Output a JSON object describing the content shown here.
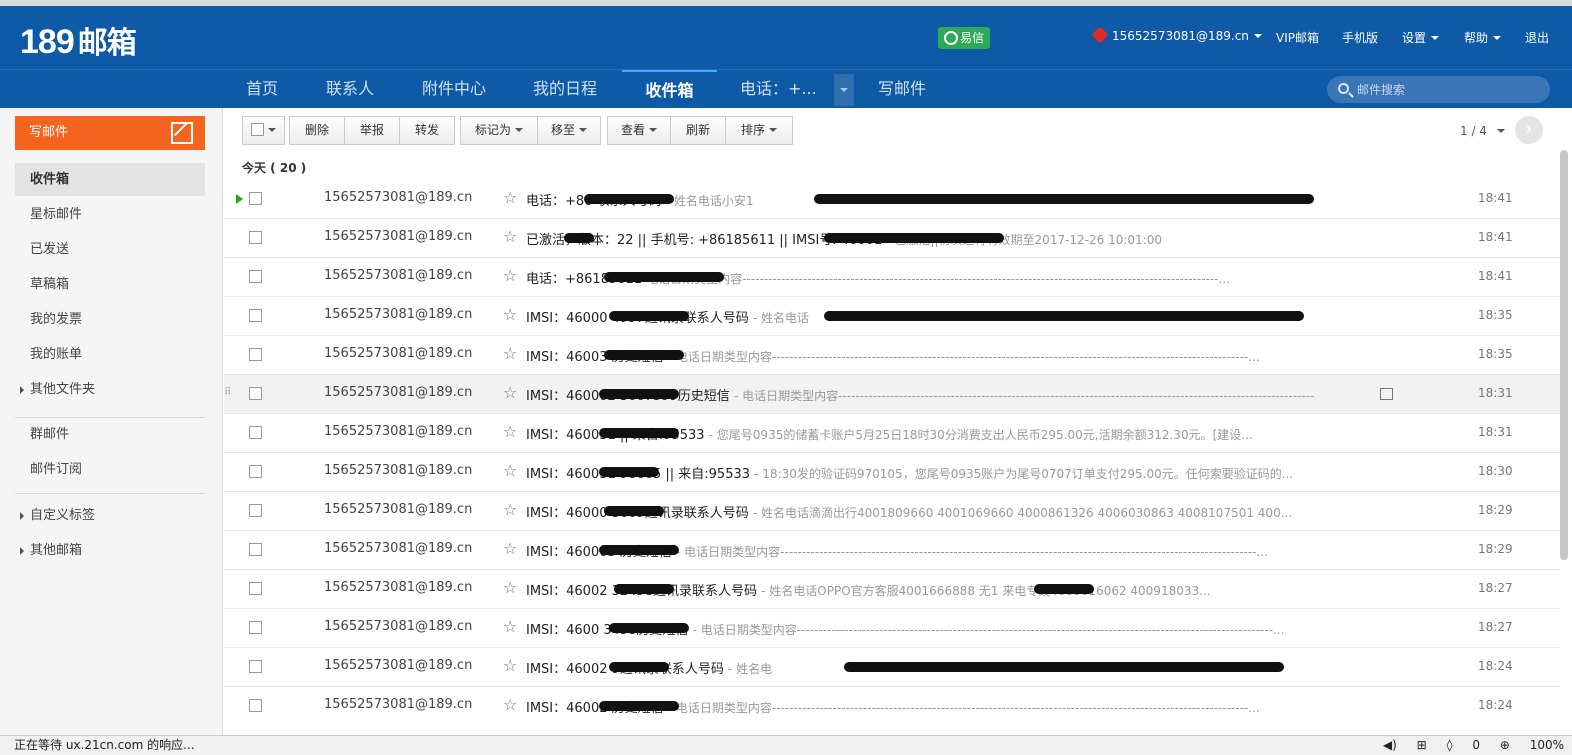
{
  "header": {
    "logo_num": "189",
    "logo_text": "邮箱",
    "yixin": "易信",
    "account": "15652573081@189.cn",
    "vip": "VIP邮箱",
    "mobile": "手机版",
    "settings": "设置",
    "help": "帮助",
    "logout": "退出"
  },
  "nav": {
    "home": "首页",
    "contacts": "联系人",
    "attachments": "附件中心",
    "schedule": "我的日程",
    "inbox": "收件箱",
    "phone": "电话：+...",
    "compose": "写邮件",
    "search_placeholder": "邮件搜索"
  },
  "sidebar": {
    "compose": "写邮件",
    "items": [
      "收件箱",
      "星标邮件",
      "已发送",
      "草稿箱",
      "我的发票",
      "我的账单",
      "其他文件夹"
    ],
    "items2": [
      "群邮件",
      "邮件订阅"
    ],
    "items3": [
      "自定义标签",
      "其他邮箱"
    ]
  },
  "toolbar": {
    "delete": "删除",
    "report": "举报",
    "forward": "转发",
    "mark": "标记为",
    "move": "移至",
    "view": "查看",
    "refresh": "刷新",
    "sort": "排序",
    "page": "1 / 4"
  },
  "day_label": "今天 ( 20 )",
  "emails": [
    {
      "from": "15652573081@189.cn",
      "subject": "电话：+86 联系人号码",
      "preview": "- 姓名电话小安1",
      "time": "18:41"
    },
    {
      "from": "15652573081@189.cn",
      "subject": "已激活，版本：22 || 手机号: +86185611 || IMSI号: 46001",
      "preview": "- 已激活||初次运行有效期至2017-12-26 10:01:00",
      "time": "18:41"
    },
    {
      "from": "15652573081@189.cn",
      "subject": "电话：+86185611",
      "preview": "电话日期类型内容--------------------------------------------------------------------------------------------------------------...",
      "time": "18:41"
    },
    {
      "from": "15652573081@189.cn",
      "subject": "IMSI：46000 4997通讯录联系人号码",
      "preview": "- 姓名电话",
      "time": "18:35"
    },
    {
      "from": "15652573081@189.cn",
      "subject": "IMSI：46003 历史短信",
      "preview": "- 电话日期类型内容--------------------------------------------------------------------------------------------------------------...",
      "time": "18:35"
    },
    {
      "from": "15652573081@189.cn",
      "subject": "IMSI：460002 3667599历史短信",
      "preview": "- 电话日期类型内容--------------------------------------------------------------------------------------------------------------...",
      "time": "18:31"
    },
    {
      "from": "15652573081@189.cn",
      "subject": "IMSI：460031 || 来自:95533",
      "preview": "- 您尾号0935的储蓄卡账户5月25日18时30分消费支出人民币295.00元,活期余额312.30元。[建设...",
      "time": "18:31"
    },
    {
      "from": "15652573081@189.cn",
      "subject": "IMSI：460031 98665 || 来自:95533",
      "preview": "- 18:30发的验证码970105，您尾号0935账户为尾号0707订单支付295.00元。任何索要验证码的...",
      "time": "18:30"
    },
    {
      "from": "15652573081@189.cn",
      "subject": "IMSI：46000 3669通讯录联系人号码",
      "preview": "- 姓名电话滴滴出行4001809660 4001069660 4000861326 4006030863 4008107501 400...",
      "time": "18:29"
    },
    {
      "from": "15652573081@189.cn",
      "subject": "IMSI：460003 历史短信",
      "preview": "- 电话日期类型内容--------------------------------------------------------------------------------------------------------------...",
      "time": "18:29"
    },
    {
      "from": "15652573081@189.cn",
      "subject": "IMSI：46002 32458通讯录联系人号码",
      "preview": "- 姓名电话OPPO官方客服4001666888 无1 来电专线4008016062 400918033...",
      "time": "18:27"
    },
    {
      "from": "15652573081@189.cn",
      "subject": "IMSI：4600 3458历史短信",
      "preview": "- 电话日期类型内容--------------------------------------------------------------------------------------------------------------...",
      "time": "18:27"
    },
    {
      "from": "15652573081@189.cn",
      "subject": "IMSI：46002 9通讯录联系人号码",
      "preview": "- 姓名电",
      "time": "18:24"
    },
    {
      "from": "15652573081@189.cn",
      "subject": "IMSI：46002 历史短信",
      "preview": "- 电话日期类型内容--------------------------------------------------------------------------------------------------------------...",
      "time": "18:24"
    }
  ],
  "status": {
    "text": "正在等待 ux.21cn.com 的响应...",
    "zero": "0",
    "zoom": "100%"
  }
}
